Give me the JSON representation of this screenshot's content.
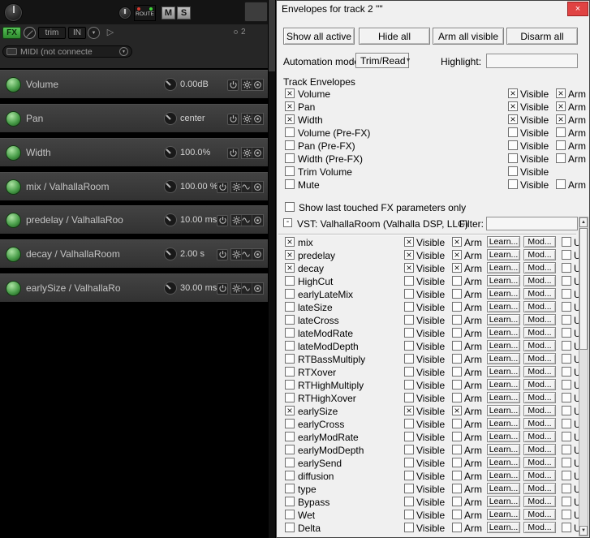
{
  "icons": {
    "chevron_down": "▼",
    "triangle_right": "▷",
    "scroll_up": "▲",
    "scroll_down": "▼"
  },
  "left_panel": {
    "header": {
      "route_label": "ROUTE",
      "mute_label": "M",
      "solo_label": "S",
      "fx_label": "FX",
      "trim_label": "trim",
      "in_label": "IN",
      "midi_label": "MIDI (not connecte",
      "track_marker": "2"
    },
    "lanes": [
      {
        "name": "Volume",
        "value": "0.00dB",
        "fx_param": false
      },
      {
        "name": "Pan",
        "value": "center",
        "fx_param": false
      },
      {
        "name": "Width",
        "value": "100.0%",
        "fx_param": false
      },
      {
        "name": "mix / ValhallaRoom",
        "value": "100.00 %",
        "fx_param": true
      },
      {
        "name": "predelay / ValhallaRoo",
        "value": "10.00 ms",
        "fx_param": true
      },
      {
        "name": "decay / ValhallaRoom",
        "value": "2.00 s",
        "fx_param": true
      },
      {
        "name": "earlySize / ValhallaRo",
        "value": "30.00 ms",
        "fx_param": true
      }
    ]
  },
  "dialog": {
    "title": "Envelopes for track 2 \"\"",
    "close_glyph": "×",
    "toolbar": {
      "show_all_active": "Show all active",
      "hide_all": "Hide all",
      "arm_all_visible": "Arm all visible",
      "disarm_all": "Disarm all"
    },
    "automation_mode_label": "Automation mode:",
    "automation_mode_value": "Trim/Read",
    "highlight_label": "Highlight:",
    "highlight_value": "",
    "track_envelopes_label": "Track Envelopes",
    "labels": {
      "visible": "Visible",
      "arm": "Arm",
      "learn": "Learn...",
      "mod": "Mod...",
      "ui": "UI"
    },
    "track_envelopes": [
      {
        "name": "Volume",
        "checked": true,
        "visible_checked": true,
        "has_arm": true,
        "arm_checked": true
      },
      {
        "name": "Pan",
        "checked": true,
        "visible_checked": true,
        "has_arm": true,
        "arm_checked": true
      },
      {
        "name": "Width",
        "checked": true,
        "visible_checked": true,
        "has_arm": true,
        "arm_checked": true
      },
      {
        "name": "Volume (Pre-FX)",
        "checked": false,
        "visible_checked": false,
        "has_arm": true,
        "arm_checked": false
      },
      {
        "name": "Pan (Pre-FX)",
        "checked": false,
        "visible_checked": false,
        "has_arm": true,
        "arm_checked": false
      },
      {
        "name": "Width (Pre-FX)",
        "checked": false,
        "visible_checked": false,
        "has_arm": true,
        "arm_checked": false
      },
      {
        "name": "Trim Volume",
        "checked": false,
        "visible_checked": false,
        "has_arm": false,
        "arm_checked": false
      },
      {
        "name": "Mute",
        "checked": false,
        "visible_checked": false,
        "has_arm": true,
        "arm_checked": false
      }
    ],
    "show_last_touched_label": "Show last touched FX parameters only",
    "show_last_touched_checked": false,
    "vst_section": {
      "collapse_glyph": "-",
      "label": "VST: ValhallaRoom (Valhalla DSP, LLC)",
      "filter_label": "Filter:",
      "filter_value": ""
    },
    "fx_params": [
      {
        "name": "mix",
        "checked": true,
        "visible_checked": true,
        "arm_checked": true,
        "ui_checked": false
      },
      {
        "name": "predelay",
        "checked": true,
        "visible_checked": true,
        "arm_checked": true,
        "ui_checked": false
      },
      {
        "name": "decay",
        "checked": true,
        "visible_checked": true,
        "arm_checked": true,
        "ui_checked": false
      },
      {
        "name": "HighCut",
        "checked": false,
        "visible_checked": false,
        "arm_checked": false,
        "ui_checked": false
      },
      {
        "name": "earlyLateMix",
        "checked": false,
        "visible_checked": false,
        "arm_checked": false,
        "ui_checked": false
      },
      {
        "name": "lateSize",
        "checked": false,
        "visible_checked": false,
        "arm_checked": false,
        "ui_checked": false
      },
      {
        "name": "lateCross",
        "checked": false,
        "visible_checked": false,
        "arm_checked": false,
        "ui_checked": false
      },
      {
        "name": "lateModRate",
        "checked": false,
        "visible_checked": false,
        "arm_checked": false,
        "ui_checked": false
      },
      {
        "name": "lateModDepth",
        "checked": false,
        "visible_checked": false,
        "arm_checked": false,
        "ui_checked": false
      },
      {
        "name": "RTBassMultiply",
        "checked": false,
        "visible_checked": false,
        "arm_checked": false,
        "ui_checked": false
      },
      {
        "name": "RTXover",
        "checked": false,
        "visible_checked": false,
        "arm_checked": false,
        "ui_checked": false
      },
      {
        "name": "RTHighMultiply",
        "checked": false,
        "visible_checked": false,
        "arm_checked": false,
        "ui_checked": false
      },
      {
        "name": "RTHighXover",
        "checked": false,
        "visible_checked": false,
        "arm_checked": false,
        "ui_checked": false
      },
      {
        "name": "earlySize",
        "checked": true,
        "visible_checked": true,
        "arm_checked": true,
        "ui_checked": false
      },
      {
        "name": "earlyCross",
        "checked": false,
        "visible_checked": false,
        "arm_checked": false,
        "ui_checked": false
      },
      {
        "name": "earlyModRate",
        "checked": false,
        "visible_checked": false,
        "arm_checked": false,
        "ui_checked": false
      },
      {
        "name": "earlyModDepth",
        "checked": false,
        "visible_checked": false,
        "arm_checked": false,
        "ui_checked": false
      },
      {
        "name": "earlySend",
        "checked": false,
        "visible_checked": false,
        "arm_checked": false,
        "ui_checked": false
      },
      {
        "name": "diffusion",
        "checked": false,
        "visible_checked": false,
        "arm_checked": false,
        "ui_checked": false
      },
      {
        "name": "type",
        "checked": false,
        "visible_checked": false,
        "arm_checked": false,
        "ui_checked": false
      },
      {
        "name": "Bypass",
        "checked": false,
        "visible_checked": false,
        "arm_checked": false,
        "ui_checked": false
      },
      {
        "name": "Wet",
        "checked": false,
        "visible_checked": false,
        "arm_checked": false,
        "ui_checked": false
      },
      {
        "name": "Delta",
        "checked": false,
        "visible_checked": false,
        "arm_checked": false,
        "ui_checked": false
      }
    ]
  }
}
